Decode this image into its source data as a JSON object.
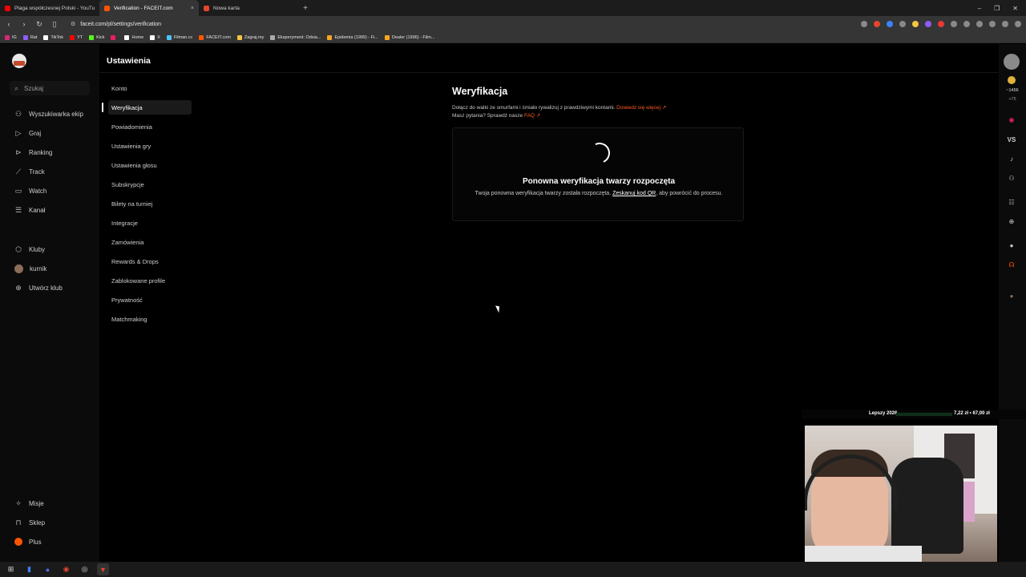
{
  "browser": {
    "tabs": [
      {
        "label": "Plaga współczesnej Polski - YouTube",
        "color": "#ff0000"
      },
      {
        "label": "Verification - FACEIT.com",
        "color": "#ff5500"
      },
      {
        "label": "Nowa karta",
        "color": "#e5462b"
      }
    ],
    "tab_close": "×",
    "new_tab": "+",
    "url": "faceit.com/pl/settings/verification",
    "bookmarks": [
      {
        "label": "IG",
        "color": "#d62976"
      },
      {
        "label": "Rat",
        "color": "#8b5cf6"
      },
      {
        "label": "TikTok",
        "color": "#ffffff"
      },
      {
        "label": "YT",
        "color": "#ff0000"
      },
      {
        "label": "Kick",
        "color": "#53fc18"
      },
      {
        "label": "",
        "color": "#e91e63"
      },
      {
        "label": "Home",
        "color": "#ffffff"
      },
      {
        "label": "X",
        "color": "#ffffff"
      },
      {
        "label": "Filman.cc",
        "color": "#4fc3f7"
      },
      {
        "label": "FACEIT.com",
        "color": "#ff5500"
      },
      {
        "label": "Zagraj.my",
        "color": "#f5c542"
      },
      {
        "label": "Eksperyment: Odsia...",
        "color": "#aaaaaa"
      },
      {
        "label": "Epidemia (1995) - Fi...",
        "color": "#f5a623"
      },
      {
        "label": "Dealer (1996) - Film...",
        "color": "#f5a623"
      }
    ]
  },
  "leftnav": {
    "search": "Szukaj",
    "items": [
      {
        "label": "Wyszukiwarka ekip",
        "icon": "users-icon"
      },
      {
        "label": "Graj",
        "icon": "play-icon"
      },
      {
        "label": "Ranking",
        "icon": "ranking-icon"
      },
      {
        "label": "Track",
        "icon": "track-icon"
      },
      {
        "label": "Watch",
        "icon": "watch-icon"
      },
      {
        "label": "Kanał",
        "icon": "feed-icon"
      }
    ],
    "clubs": [
      {
        "label": "Kluby"
      },
      {
        "label": "kurnik"
      },
      {
        "label": "Utwórz klub"
      }
    ],
    "bottom": [
      {
        "label": "Misje"
      },
      {
        "label": "Sklep"
      },
      {
        "label": "Plus"
      }
    ]
  },
  "page": {
    "title": "Ustawienia"
  },
  "settings_nav": [
    "Konto",
    "Weryfikacja",
    "Powiadomienia",
    "Ustawienia gry",
    "Ustawienia głosu",
    "Subskrypcje",
    "Bilety na turniej",
    "Integracje",
    "Zamówienia",
    "Rewards & Drops",
    "Zablokowane profile",
    "Prywatność",
    "Matchmaking"
  ],
  "verification": {
    "title": "Weryfikacja",
    "line1": "Dołącz do walki ze smurfami i śmiało rywalizuj z prawdziwymi kontami.",
    "line1_link": "Dowiedz się więcej",
    "line2": "Masz pytania? Sprawdź nasze",
    "line2_link": "FAQ",
    "card_title": "Ponowna weryfikacja twarzy rozpoczęta",
    "card_text_a": "Twoja ponowna weryfikacja twarzy została rozpoczęta.",
    "card_text_link": "Zeskanuj kod QR",
    "card_text_b": ", aby powrócić do procesu."
  },
  "rightrail": {
    "points": "1456",
    "delta": "+75",
    "vs": "VS"
  },
  "overlay": {
    "left": "Lepszy 2026",
    "right": "7,22 zł • 67,00 zł"
  },
  "colors": {
    "accent": "#ff5500",
    "link": "#ff5a1f"
  }
}
